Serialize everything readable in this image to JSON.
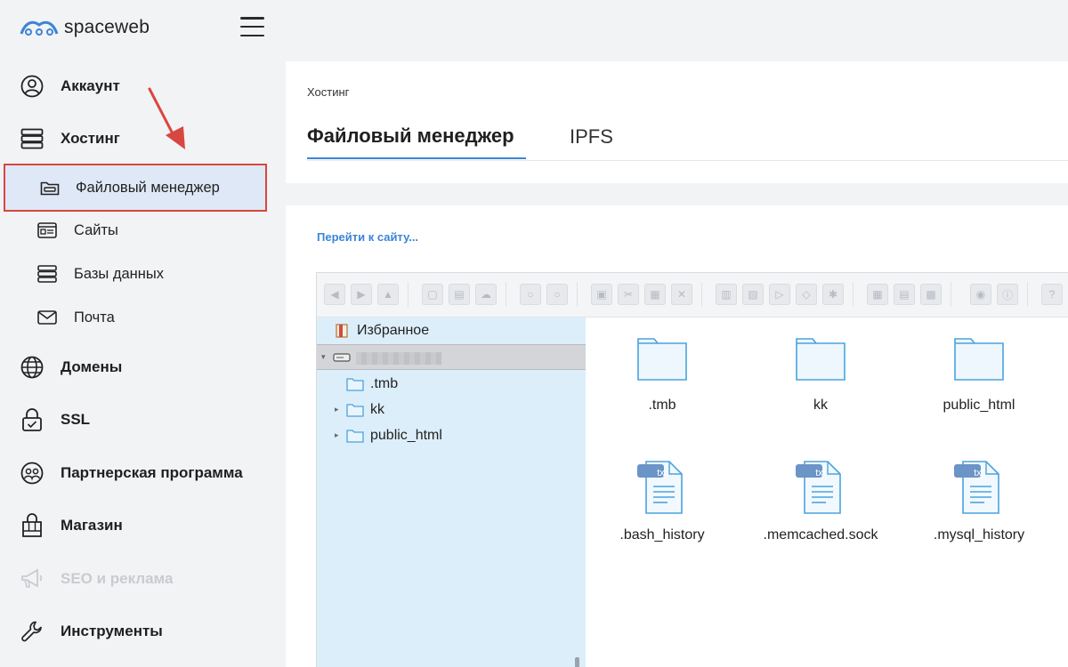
{
  "brand": {
    "name": "spaceweb",
    "color": "#3b84d8"
  },
  "sidebar": {
    "items": [
      {
        "label": "Аккаунт",
        "icon": "user-icon"
      },
      {
        "label": "Хостинг",
        "icon": "server-icon"
      },
      {
        "label": "Файловый менеджер",
        "icon": "folder-icon",
        "sub": true,
        "active": true
      },
      {
        "label": "Сайты",
        "icon": "site-card-icon",
        "sub": true
      },
      {
        "label": "Базы данных",
        "icon": "database-icon",
        "sub": true
      },
      {
        "label": "Почта",
        "icon": "mail-icon",
        "sub": true
      },
      {
        "label": "Домены",
        "icon": "globe-icon"
      },
      {
        "label": "SSL",
        "icon": "lock-icon"
      },
      {
        "label": "Партнерская программа",
        "icon": "partners-icon"
      },
      {
        "label": "Магазин",
        "icon": "shop-bag-icon"
      },
      {
        "label": "SEO и реклама",
        "icon": "megaphone-icon",
        "disabled": true
      },
      {
        "label": "Инструменты",
        "icon": "wrench-icon"
      }
    ]
  },
  "header": {
    "breadcrumb": "Хостинг",
    "tabs": [
      {
        "label": "Файловый менеджер",
        "active": true
      },
      {
        "label": "IPFS",
        "active": false
      }
    ]
  },
  "main": {
    "goto_link": "Перейти к сайту...",
    "tree": {
      "favorites": "Избранное",
      "root": "",
      "children": [
        ".tmb",
        "kk",
        "public_html"
      ]
    },
    "files": [
      {
        "name": ".tmb",
        "type": "folder"
      },
      {
        "name": "kk",
        "type": "folder"
      },
      {
        "name": "public_html",
        "type": "folder"
      },
      {
        "name": ".bash_history",
        "type": "txt"
      },
      {
        "name": ".memcached.sock",
        "type": "txt"
      },
      {
        "name": ".mysql_history",
        "type": "txt"
      }
    ],
    "txt_badge": "txt"
  },
  "colors": {
    "highlight_border": "#d8473f",
    "folder_stroke": "#4aa3dd",
    "tree_bg": "#dceefa",
    "tab_underline": "#3b84d8"
  }
}
